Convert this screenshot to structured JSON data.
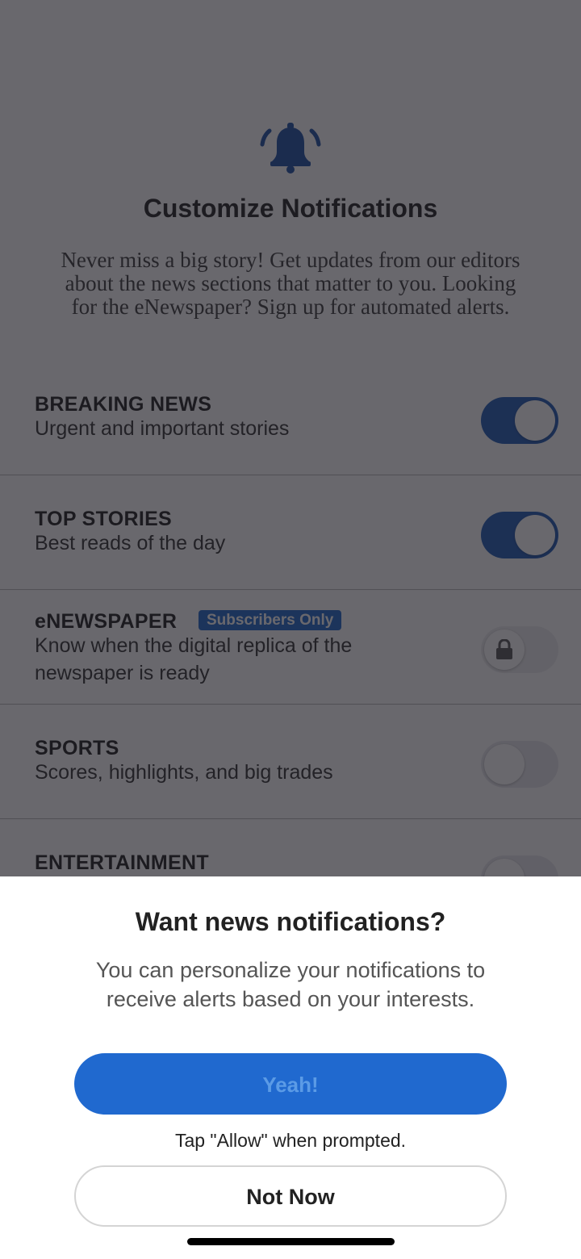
{
  "screen": {
    "title": "Customize Notifications",
    "intro": "Never miss a big story! Get updates from our editors about the news sections that matter to you. Looking for the eNewspaper? Sign up for automated alerts.",
    "icon": "bell-icon"
  },
  "settings": [
    {
      "title": "BREAKING NEWS",
      "description": "Urgent and important stories",
      "enabled": true
    },
    {
      "title": "TOP STORIES",
      "description": "Best reads of the day",
      "enabled": true
    },
    {
      "title": "eNEWSPAPER",
      "badge": "Subscribers Only",
      "description": "Know when the digital replica of the newspaper is ready",
      "enabled": false,
      "locked": true
    },
    {
      "title": "SPORTS",
      "description": "Scores, highlights, and big trades",
      "enabled": false
    },
    {
      "title": "ENTERTAINMENT",
      "enabled": false
    }
  ],
  "prompt": {
    "title": "Want news notifications?",
    "body": "You can personalize your notifications to receive alerts based on your interests.",
    "primary_button": "Yeah!",
    "hint": "Tap \"Allow\" when prompted.",
    "secondary_button": "Not Now"
  },
  "colors": {
    "accent": "#1f5bb7",
    "primary_button": "#2069cf",
    "badge": "#1f66c9",
    "overlay": "rgba(28,26,34,0.66)"
  }
}
